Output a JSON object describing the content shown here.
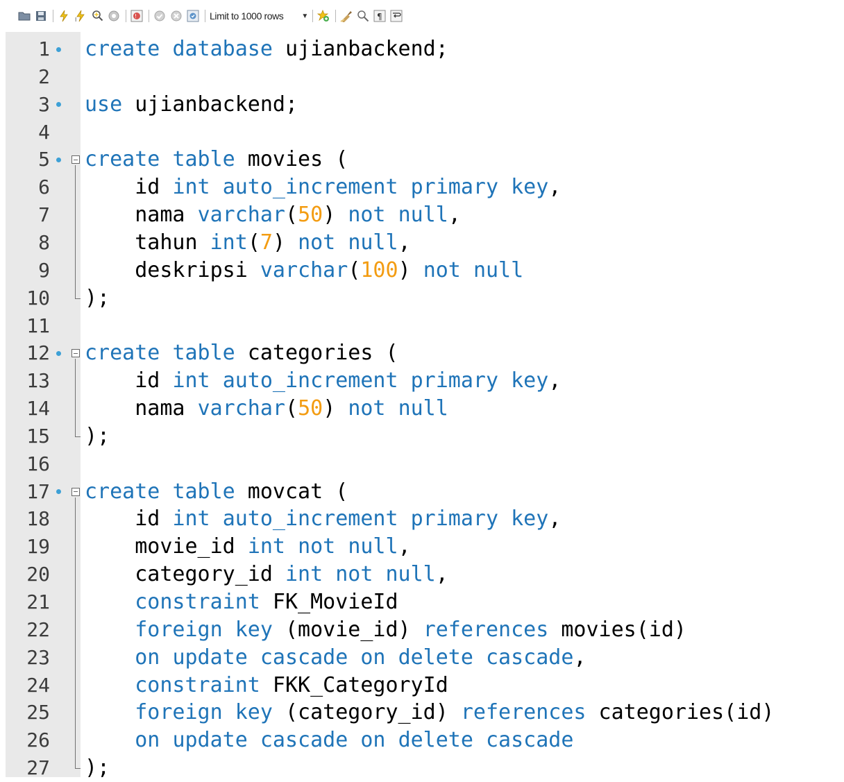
{
  "toolbar": {
    "icons": [
      "open-folder-icon",
      "save-icon",
      "execute-icon",
      "execute-current-icon",
      "explain-icon",
      "stop-icon",
      "toggle-error-icon",
      "commit-icon",
      "rollback-icon",
      "autocommit-icon"
    ],
    "limit_label": "Limit to 1000 rows",
    "right_icons": [
      "add-snippet-icon",
      "beautify-icon",
      "find-icon",
      "invisible-chars-icon",
      "wrap-icon"
    ]
  },
  "editor": {
    "keyword_color": "#1f74b8",
    "number_color": "#f39c12",
    "lines": [
      {
        "n": "1",
        "marker": true,
        "fold": false,
        "tokens": [
          [
            "k",
            "create"
          ],
          [
            "i",
            " "
          ],
          [
            "k",
            "database"
          ],
          [
            "i",
            " ujianbackend;"
          ]
        ]
      },
      {
        "n": "2",
        "tokens": []
      },
      {
        "n": "3",
        "marker": true,
        "tokens": [
          [
            "k",
            "use"
          ],
          [
            "i",
            " ujianbackend;"
          ]
        ]
      },
      {
        "n": "4",
        "tokens": []
      },
      {
        "n": "5",
        "marker": true,
        "fold": true,
        "tokens": [
          [
            "k",
            "create"
          ],
          [
            "i",
            " "
          ],
          [
            "k",
            "table"
          ],
          [
            "i",
            " movies ("
          ]
        ]
      },
      {
        "n": "6",
        "tokens": [
          [
            "i",
            "    id "
          ],
          [
            "k",
            "int"
          ],
          [
            "i",
            " "
          ],
          [
            "k",
            "auto_increment"
          ],
          [
            "i",
            " "
          ],
          [
            "k",
            "primary"
          ],
          [
            "i",
            " "
          ],
          [
            "k",
            "key"
          ],
          [
            "i",
            ","
          ]
        ]
      },
      {
        "n": "7",
        "tokens": [
          [
            "i",
            "    nama "
          ],
          [
            "k",
            "varchar"
          ],
          [
            "i",
            "("
          ],
          [
            "n",
            "50"
          ],
          [
            "i",
            ") "
          ],
          [
            "k",
            "not"
          ],
          [
            "i",
            " "
          ],
          [
            "k",
            "null"
          ],
          [
            "i",
            ","
          ]
        ]
      },
      {
        "n": "8",
        "tokens": [
          [
            "i",
            "    tahun "
          ],
          [
            "k",
            "int"
          ],
          [
            "i",
            "("
          ],
          [
            "n",
            "7"
          ],
          [
            "i",
            ") "
          ],
          [
            "k",
            "not"
          ],
          [
            "i",
            " "
          ],
          [
            "k",
            "null"
          ],
          [
            "i",
            ","
          ]
        ]
      },
      {
        "n": "9",
        "tokens": [
          [
            "i",
            "    deskripsi "
          ],
          [
            "k",
            "varchar"
          ],
          [
            "i",
            "("
          ],
          [
            "n",
            "100"
          ],
          [
            "i",
            ") "
          ],
          [
            "k",
            "not"
          ],
          [
            "i",
            " "
          ],
          [
            "k",
            "null"
          ]
        ]
      },
      {
        "n": "10",
        "tokens": [
          [
            "i",
            ");"
          ]
        ]
      },
      {
        "n": "11",
        "tokens": []
      },
      {
        "n": "12",
        "marker": true,
        "fold": true,
        "tokens": [
          [
            "k",
            "create"
          ],
          [
            "i",
            " "
          ],
          [
            "k",
            "table"
          ],
          [
            "i",
            " categories ("
          ]
        ]
      },
      {
        "n": "13",
        "tokens": [
          [
            "i",
            "    id "
          ],
          [
            "k",
            "int"
          ],
          [
            "i",
            " "
          ],
          [
            "k",
            "auto_increment"
          ],
          [
            "i",
            " "
          ],
          [
            "k",
            "primary"
          ],
          [
            "i",
            " "
          ],
          [
            "k",
            "key"
          ],
          [
            "i",
            ","
          ]
        ]
      },
      {
        "n": "14",
        "tokens": [
          [
            "i",
            "    nama "
          ],
          [
            "k",
            "varchar"
          ],
          [
            "i",
            "("
          ],
          [
            "n",
            "50"
          ],
          [
            "i",
            ") "
          ],
          [
            "k",
            "not"
          ],
          [
            "i",
            " "
          ],
          [
            "k",
            "null"
          ]
        ]
      },
      {
        "n": "15",
        "tokens": [
          [
            "i",
            ");"
          ]
        ]
      },
      {
        "n": "16",
        "tokens": []
      },
      {
        "n": "17",
        "marker": true,
        "fold": true,
        "tokens": [
          [
            "k",
            "create"
          ],
          [
            "i",
            " "
          ],
          [
            "k",
            "table"
          ],
          [
            "i",
            " movcat ("
          ]
        ]
      },
      {
        "n": "18",
        "tokens": [
          [
            "i",
            "    id "
          ],
          [
            "k",
            "int"
          ],
          [
            "i",
            " "
          ],
          [
            "k",
            "auto_increment"
          ],
          [
            "i",
            " "
          ],
          [
            "k",
            "primary"
          ],
          [
            "i",
            " "
          ],
          [
            "k",
            "key"
          ],
          [
            "i",
            ","
          ]
        ]
      },
      {
        "n": "19",
        "tokens": [
          [
            "i",
            "    movie_id "
          ],
          [
            "k",
            "int"
          ],
          [
            "i",
            " "
          ],
          [
            "k",
            "not"
          ],
          [
            "i",
            " "
          ],
          [
            "k",
            "null"
          ],
          [
            "i",
            ","
          ]
        ]
      },
      {
        "n": "20",
        "tokens": [
          [
            "i",
            "    category_id "
          ],
          [
            "k",
            "int"
          ],
          [
            "i",
            " "
          ],
          [
            "k",
            "not"
          ],
          [
            "i",
            " "
          ],
          [
            "k",
            "null"
          ],
          [
            "i",
            ","
          ]
        ]
      },
      {
        "n": "21",
        "tokens": [
          [
            "i",
            "    "
          ],
          [
            "k",
            "constraint"
          ],
          [
            "i",
            " FK_MovieId"
          ]
        ]
      },
      {
        "n": "22",
        "tokens": [
          [
            "i",
            "    "
          ],
          [
            "k",
            "foreign"
          ],
          [
            "i",
            " "
          ],
          [
            "k",
            "key"
          ],
          [
            "i",
            " (movie_id) "
          ],
          [
            "k",
            "references"
          ],
          [
            "i",
            " movies(id)"
          ]
        ]
      },
      {
        "n": "23",
        "tokens": [
          [
            "i",
            "    "
          ],
          [
            "k",
            "on"
          ],
          [
            "i",
            " "
          ],
          [
            "k",
            "update"
          ],
          [
            "i",
            " "
          ],
          [
            "k",
            "cascade"
          ],
          [
            "i",
            " "
          ],
          [
            "k",
            "on"
          ],
          [
            "i",
            " "
          ],
          [
            "k",
            "delete"
          ],
          [
            "i",
            " "
          ],
          [
            "k",
            "cascade"
          ],
          [
            "i",
            ","
          ]
        ]
      },
      {
        "n": "24",
        "tokens": [
          [
            "i",
            "    "
          ],
          [
            "k",
            "constraint"
          ],
          [
            "i",
            " FKK_CategoryId"
          ]
        ]
      },
      {
        "n": "25",
        "tokens": [
          [
            "i",
            "    "
          ],
          [
            "k",
            "foreign"
          ],
          [
            "i",
            " "
          ],
          [
            "k",
            "key"
          ],
          [
            "i",
            " (category_id) "
          ],
          [
            "k",
            "references"
          ],
          [
            "i",
            " categories(id)"
          ]
        ]
      },
      {
        "n": "26",
        "tokens": [
          [
            "i",
            "    "
          ],
          [
            "k",
            "on"
          ],
          [
            "i",
            " "
          ],
          [
            "k",
            "update"
          ],
          [
            "i",
            " "
          ],
          [
            "k",
            "cascade"
          ],
          [
            "i",
            " "
          ],
          [
            "k",
            "on"
          ],
          [
            "i",
            " "
          ],
          [
            "k",
            "delete"
          ],
          [
            "i",
            " "
          ],
          [
            "k",
            "cascade"
          ]
        ]
      },
      {
        "n": "27",
        "tokens": [
          [
            "i",
            ");"
          ]
        ]
      }
    ]
  }
}
